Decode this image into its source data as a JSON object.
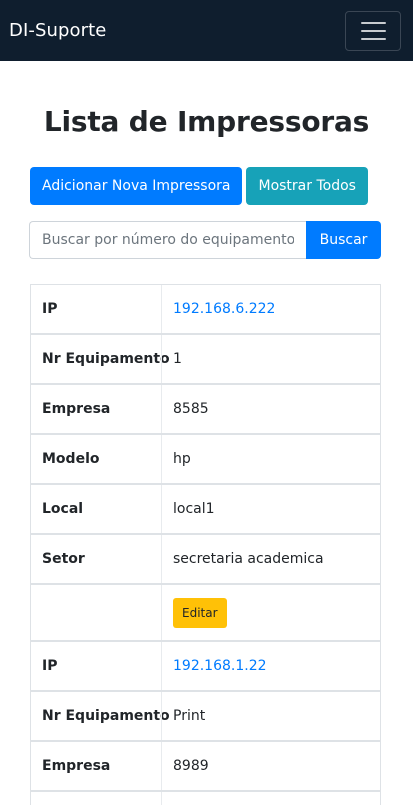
{
  "navbar": {
    "brand": "DI-Suporte"
  },
  "page": {
    "title": "Lista de Impressoras"
  },
  "actions": {
    "add_label": "Adicionar Nova Impressora",
    "show_all_label": "Mostrar Todos"
  },
  "search": {
    "placeholder": "Buscar por número do equipamento",
    "button_label": "Buscar"
  },
  "labels": {
    "ip": "IP",
    "nr": "Nr Equipamento",
    "empresa": "Empresa",
    "modelo": "Modelo",
    "local": "Local",
    "setor": "Setor",
    "edit": "Editar"
  },
  "printers": [
    {
      "ip": "192.168.6.222",
      "nr": "1",
      "empresa": "8585",
      "modelo": "hp",
      "local": "local1",
      "setor": "secretaria academica"
    },
    {
      "ip": "192.168.1.22",
      "nr": "Print",
      "empresa": "8989"
    }
  ]
}
